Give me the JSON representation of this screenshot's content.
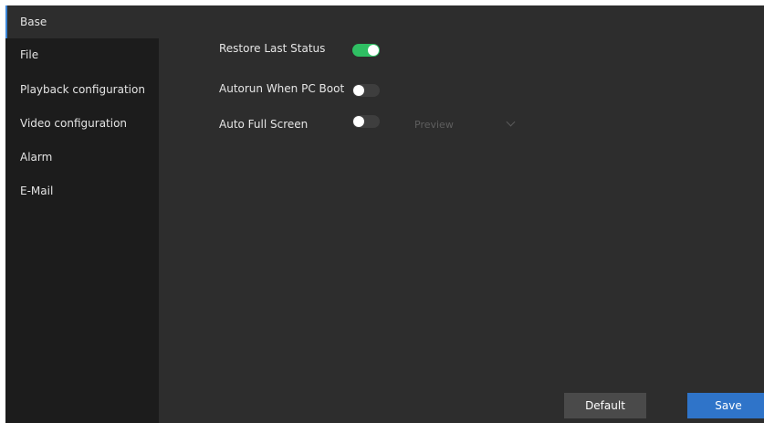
{
  "sidebar": {
    "items": [
      {
        "label": "Base",
        "active": true
      },
      {
        "label": "File",
        "active": false
      },
      {
        "label": "Playback configuration",
        "active": false
      },
      {
        "label": "Video configuration",
        "active": false
      },
      {
        "label": "Alarm",
        "active": false
      },
      {
        "label": "E-Mail",
        "active": false
      }
    ]
  },
  "options": [
    {
      "label": "Restore Last Status",
      "enabled": true
    },
    {
      "label": "Autorun When PC Boot",
      "enabled": false
    },
    {
      "label": "Auto Full Screen",
      "enabled": false
    }
  ],
  "full_screen_mode": {
    "value": "Preview",
    "icon": "chevron-down-icon"
  },
  "buttons": {
    "default_label": "Default",
    "save_label": "Save"
  },
  "colors": {
    "accent": "#3a84d6",
    "toggle_on": "#2fbf63",
    "save_button": "#2f74c9",
    "background": "#2d2d2d",
    "sidebar": "#1c1c1c"
  }
}
